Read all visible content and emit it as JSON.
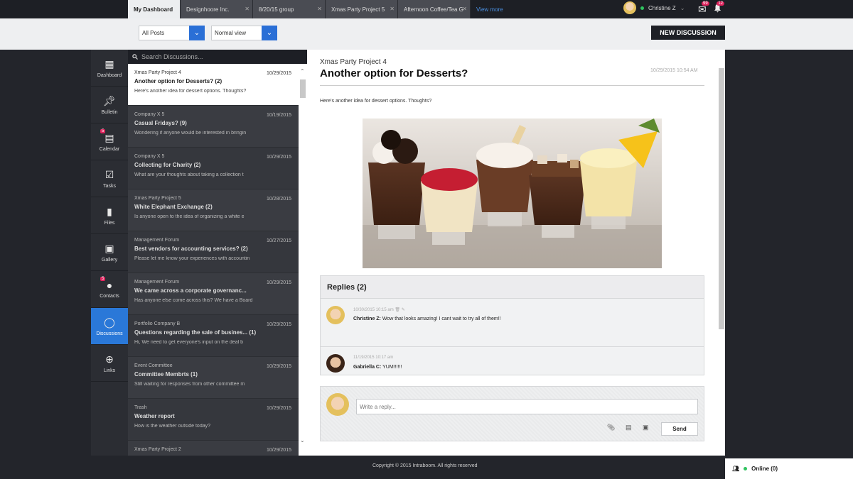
{
  "tabs": [
    {
      "label": "My Dashboard",
      "active": true
    },
    {
      "label": "Designhoore Inc.",
      "active": false
    },
    {
      "label": "8/20/15 group",
      "active": false
    },
    {
      "label": "Xmas Party Project 5",
      "active": false
    },
    {
      "label": "Afternoon Coffee/Tea G",
      "active": false
    }
  ],
  "view_more": "View more",
  "user": {
    "name": "Christine Z",
    "mail_badge": "99",
    "bell_badge": "12"
  },
  "filters": {
    "posts": "All Posts",
    "view": "Normal view"
  },
  "new_discussion": "NEW DISCUSSION",
  "nav": [
    {
      "label": "Dashboard",
      "icon": "grid-icon"
    },
    {
      "label": "Bulletin",
      "icon": "pin-icon"
    },
    {
      "label": "Calendar",
      "icon": "calendar-icon",
      "badge": "5"
    },
    {
      "label": "Tasks",
      "icon": "tasks-icon"
    },
    {
      "label": "Files",
      "icon": "file-icon"
    },
    {
      "label": "Gallery",
      "icon": "gallery-icon"
    },
    {
      "label": "Contacts",
      "icon": "contacts-icon",
      "badge": "5"
    },
    {
      "label": "Discussions",
      "icon": "chat-icon",
      "active": true
    },
    {
      "label": "Links",
      "icon": "globe-icon"
    }
  ],
  "search": {
    "placeholder": "Search Discussions..."
  },
  "discussions": [
    {
      "group": "Xmas Party Project 4",
      "date": "10/29/2015",
      "title": "Another option for Desserts? (2)",
      "preview": "Here's another idea for dessert options. Thoughts?"
    },
    {
      "group": "Company X 5",
      "date": "10/19/2015",
      "title": "Casual Fridays? (9)",
      "preview": "Wondering if anyone would be interested in bringin"
    },
    {
      "group": "Company X 5",
      "date": "10/29/2015",
      "title": "Collecting for Charity (2)",
      "preview": "What are your thoughts about taking a collection t"
    },
    {
      "group": "Xmas Party Project 5",
      "date": "10/28/2015",
      "title": "White Elephant Exchange (2)",
      "preview": "Is anyone open to the idea of organizing a white e"
    },
    {
      "group": "Management Forum",
      "date": "10/27/2015",
      "title": "Best vendors for accounting services? (2)",
      "preview": "Please let me know your experiences with accountin"
    },
    {
      "group": "Management Forum",
      "date": "10/29/2015",
      "title": "We came across a corporate governanc...",
      "preview": "Has anyone else come across this? We have a Board"
    },
    {
      "group": "Portfolio Company B",
      "date": "10/29/2015",
      "title": "Questions regarding the sale of busines... (1)",
      "preview": "Hi, We need to get everyone's input on the deal b"
    },
    {
      "group": "Event Committee",
      "date": "10/29/2015",
      "title": "Committee Membrts (1)",
      "preview": "Still waiting for responses from other committee m"
    },
    {
      "group": "Trash",
      "date": "10/29/2015",
      "title": "Weather report",
      "preview": "How is the weather outside today?"
    },
    {
      "group": "Xmas Party Project 2",
      "date": "10/29/2015",
      "title": "",
      "preview": ""
    }
  ],
  "post": {
    "group": "Xmas Party Project 4",
    "title": "Another option for Desserts?",
    "date": "10/29/2015 10:54 AM",
    "body": "Here's another idea for dessert options. Thoughts?"
  },
  "replies": {
    "header": "Replies (2)",
    "items": [
      {
        "meta": "10/30/2015 10:15 am",
        "author": "Christine Z:",
        "text": "Wow that looks amazing! I cant wait to try all of them!!"
      },
      {
        "meta": "11/19/2015 10:17 am",
        "author": "Gabriella C:",
        "text": "YUM!!!!!!"
      }
    ]
  },
  "composer": {
    "placeholder": "Write a reply...",
    "send": "Send"
  },
  "footer": {
    "copyright": "Copyright © 2015 Intraboom. All rights reserved",
    "online": "Online (0)"
  }
}
